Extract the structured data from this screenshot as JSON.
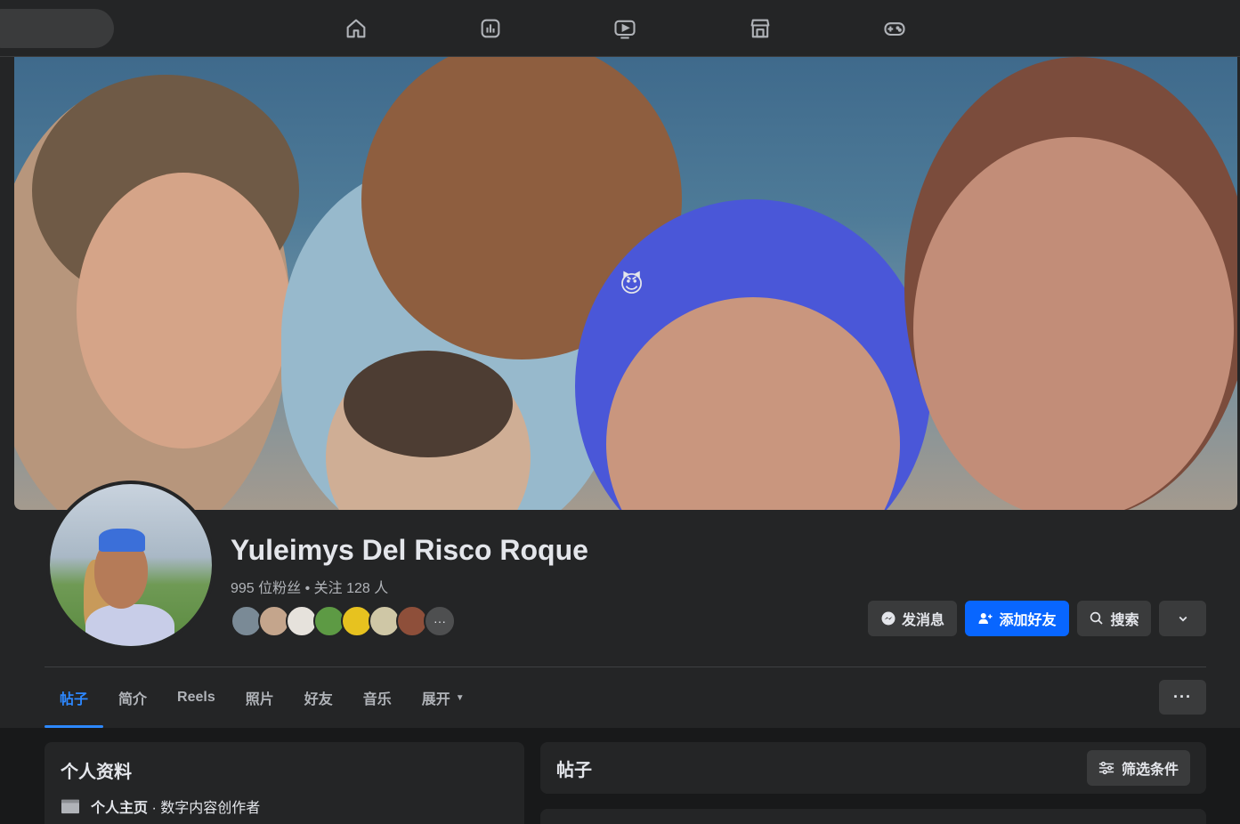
{
  "nav": {
    "icons": [
      "home-icon",
      "feed-icon",
      "video-icon",
      "marketplace-icon",
      "gaming-icon"
    ]
  },
  "profile": {
    "name": "Yuleimys Del Risco Roque",
    "stats": "995 位粉丝 • 关注 128 人"
  },
  "actions": {
    "message": "发消息",
    "add_friend": "添加好友",
    "search": "搜索"
  },
  "tabs": [
    {
      "label": "帖子",
      "active": true
    },
    {
      "label": "简介",
      "active": false
    },
    {
      "label": "Reels",
      "active": false
    },
    {
      "label": "照片",
      "active": false
    },
    {
      "label": "好友",
      "active": false
    },
    {
      "label": "音乐",
      "active": false
    },
    {
      "label": "展开",
      "active": false
    }
  ],
  "more_label": "···",
  "intro": {
    "title": "个人资料",
    "row_label": "个人主页",
    "row_value": " · 数字内容创作者"
  },
  "posts": {
    "title": "帖子",
    "filter_label": "筛选条件"
  },
  "friend_overflow": "···",
  "colors": {
    "accent": "#0866ff",
    "active_tab": "#2d88ff",
    "surface": "#242526",
    "background": "#18191a"
  }
}
